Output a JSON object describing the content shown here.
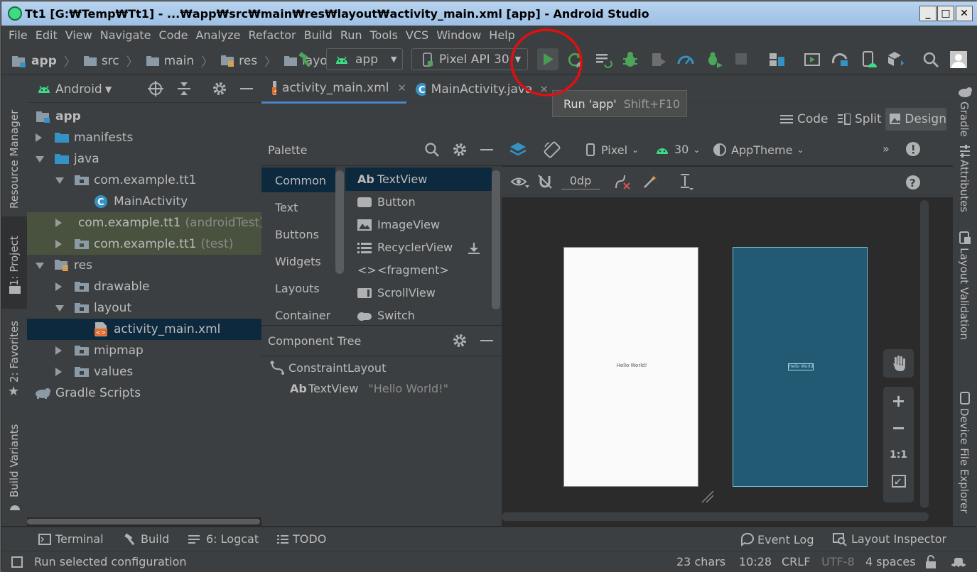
{
  "window": {
    "title": "Tt1 [G:₩Temp₩Tt1] - ...₩app₩src₩main₩res₩layout₩activity_main.xml [app] - Android Studio",
    "controls": [
      "_",
      "□",
      "✕"
    ]
  },
  "menu": [
    "File",
    "Edit",
    "View",
    "Navigate",
    "Code",
    "Analyze",
    "Refactor",
    "Build",
    "Run",
    "Tools",
    "VCS",
    "Window",
    "Help"
  ],
  "toolbar": {
    "breadcrumbs": [
      "app",
      "src",
      "main",
      "res",
      "layout"
    ],
    "run_config": "app",
    "device": "Pixel API 30",
    "tooltip_action": "Run 'app'",
    "tooltip_shortcut": "Shift+F10"
  },
  "left_strip_tabs": [
    "Resource Manager",
    "1: Project",
    "2: Favorites",
    "Build Variants"
  ],
  "project": {
    "view_mode": "Android",
    "tree": [
      {
        "label": "app",
        "extra": ""
      },
      {
        "label": "manifests",
        "extra": ""
      },
      {
        "label": "java",
        "extra": ""
      },
      {
        "label": "com.example.tt1",
        "extra": ""
      },
      {
        "label": "MainActivity",
        "extra": ""
      },
      {
        "label": "com.example.tt1",
        "extra": "(androidTest)"
      },
      {
        "label": "com.example.tt1",
        "extra": "(test)"
      },
      {
        "label": "res",
        "extra": ""
      },
      {
        "label": "drawable",
        "extra": ""
      },
      {
        "label": "layout",
        "extra": ""
      },
      {
        "label": "activity_main.xml",
        "extra": ""
      },
      {
        "label": "mipmap",
        "extra": ""
      },
      {
        "label": "values",
        "extra": ""
      },
      {
        "label": "Gradle Scripts",
        "extra": ""
      }
    ]
  },
  "editor_tabs": [
    {
      "label": "activity_main.xml",
      "active": true
    },
    {
      "label": "MainActivity.java",
      "active": false
    }
  ],
  "view_modes": [
    "Code",
    "Split",
    "Design"
  ],
  "palette": {
    "title": "Palette",
    "categories": [
      "Common",
      "Text",
      "Buttons",
      "Widgets",
      "Layouts",
      "Container"
    ],
    "items": [
      "TextView",
      "Button",
      "ImageView",
      "RecyclerView",
      "<fragment>",
      "ScrollView",
      "Switch"
    ]
  },
  "component_tree": {
    "title": "Component Tree",
    "root": "ConstraintLayout",
    "child_type": "TextView",
    "child_value": "\"Hello World!\""
  },
  "design_toolbar": {
    "device": "Pixel",
    "api": "30",
    "theme": "AppTheme",
    "margin": "0dp"
  },
  "preview": {
    "design_text": "Hello World!",
    "blueprint_text": "Hello World!"
  },
  "zoom_controls": [
    "+",
    "−",
    "1:1"
  ],
  "right_strip_tabs": [
    "Gradle",
    "Attributes",
    "Layout Validation",
    "Device File Explorer"
  ],
  "bottom_tabs": {
    "left": [
      "Terminal",
      "Build",
      "6: Logcat",
      "TODO"
    ],
    "right": [
      "Event Log",
      "Layout Inspector"
    ]
  },
  "status": {
    "message": "Run selected configuration",
    "chars": "23 chars",
    "position": "10:28",
    "line_sep": "CRLF",
    "encoding": "UTF-8",
    "indent": "4 spaces"
  },
  "colors": {
    "ide_bg": "#3c3f41",
    "editor_bg": "#2b2b2b",
    "selection": "#0d293e",
    "run_green": "#499c54",
    "blueprint": "#235a73",
    "annotation_circle": "#e01010"
  }
}
